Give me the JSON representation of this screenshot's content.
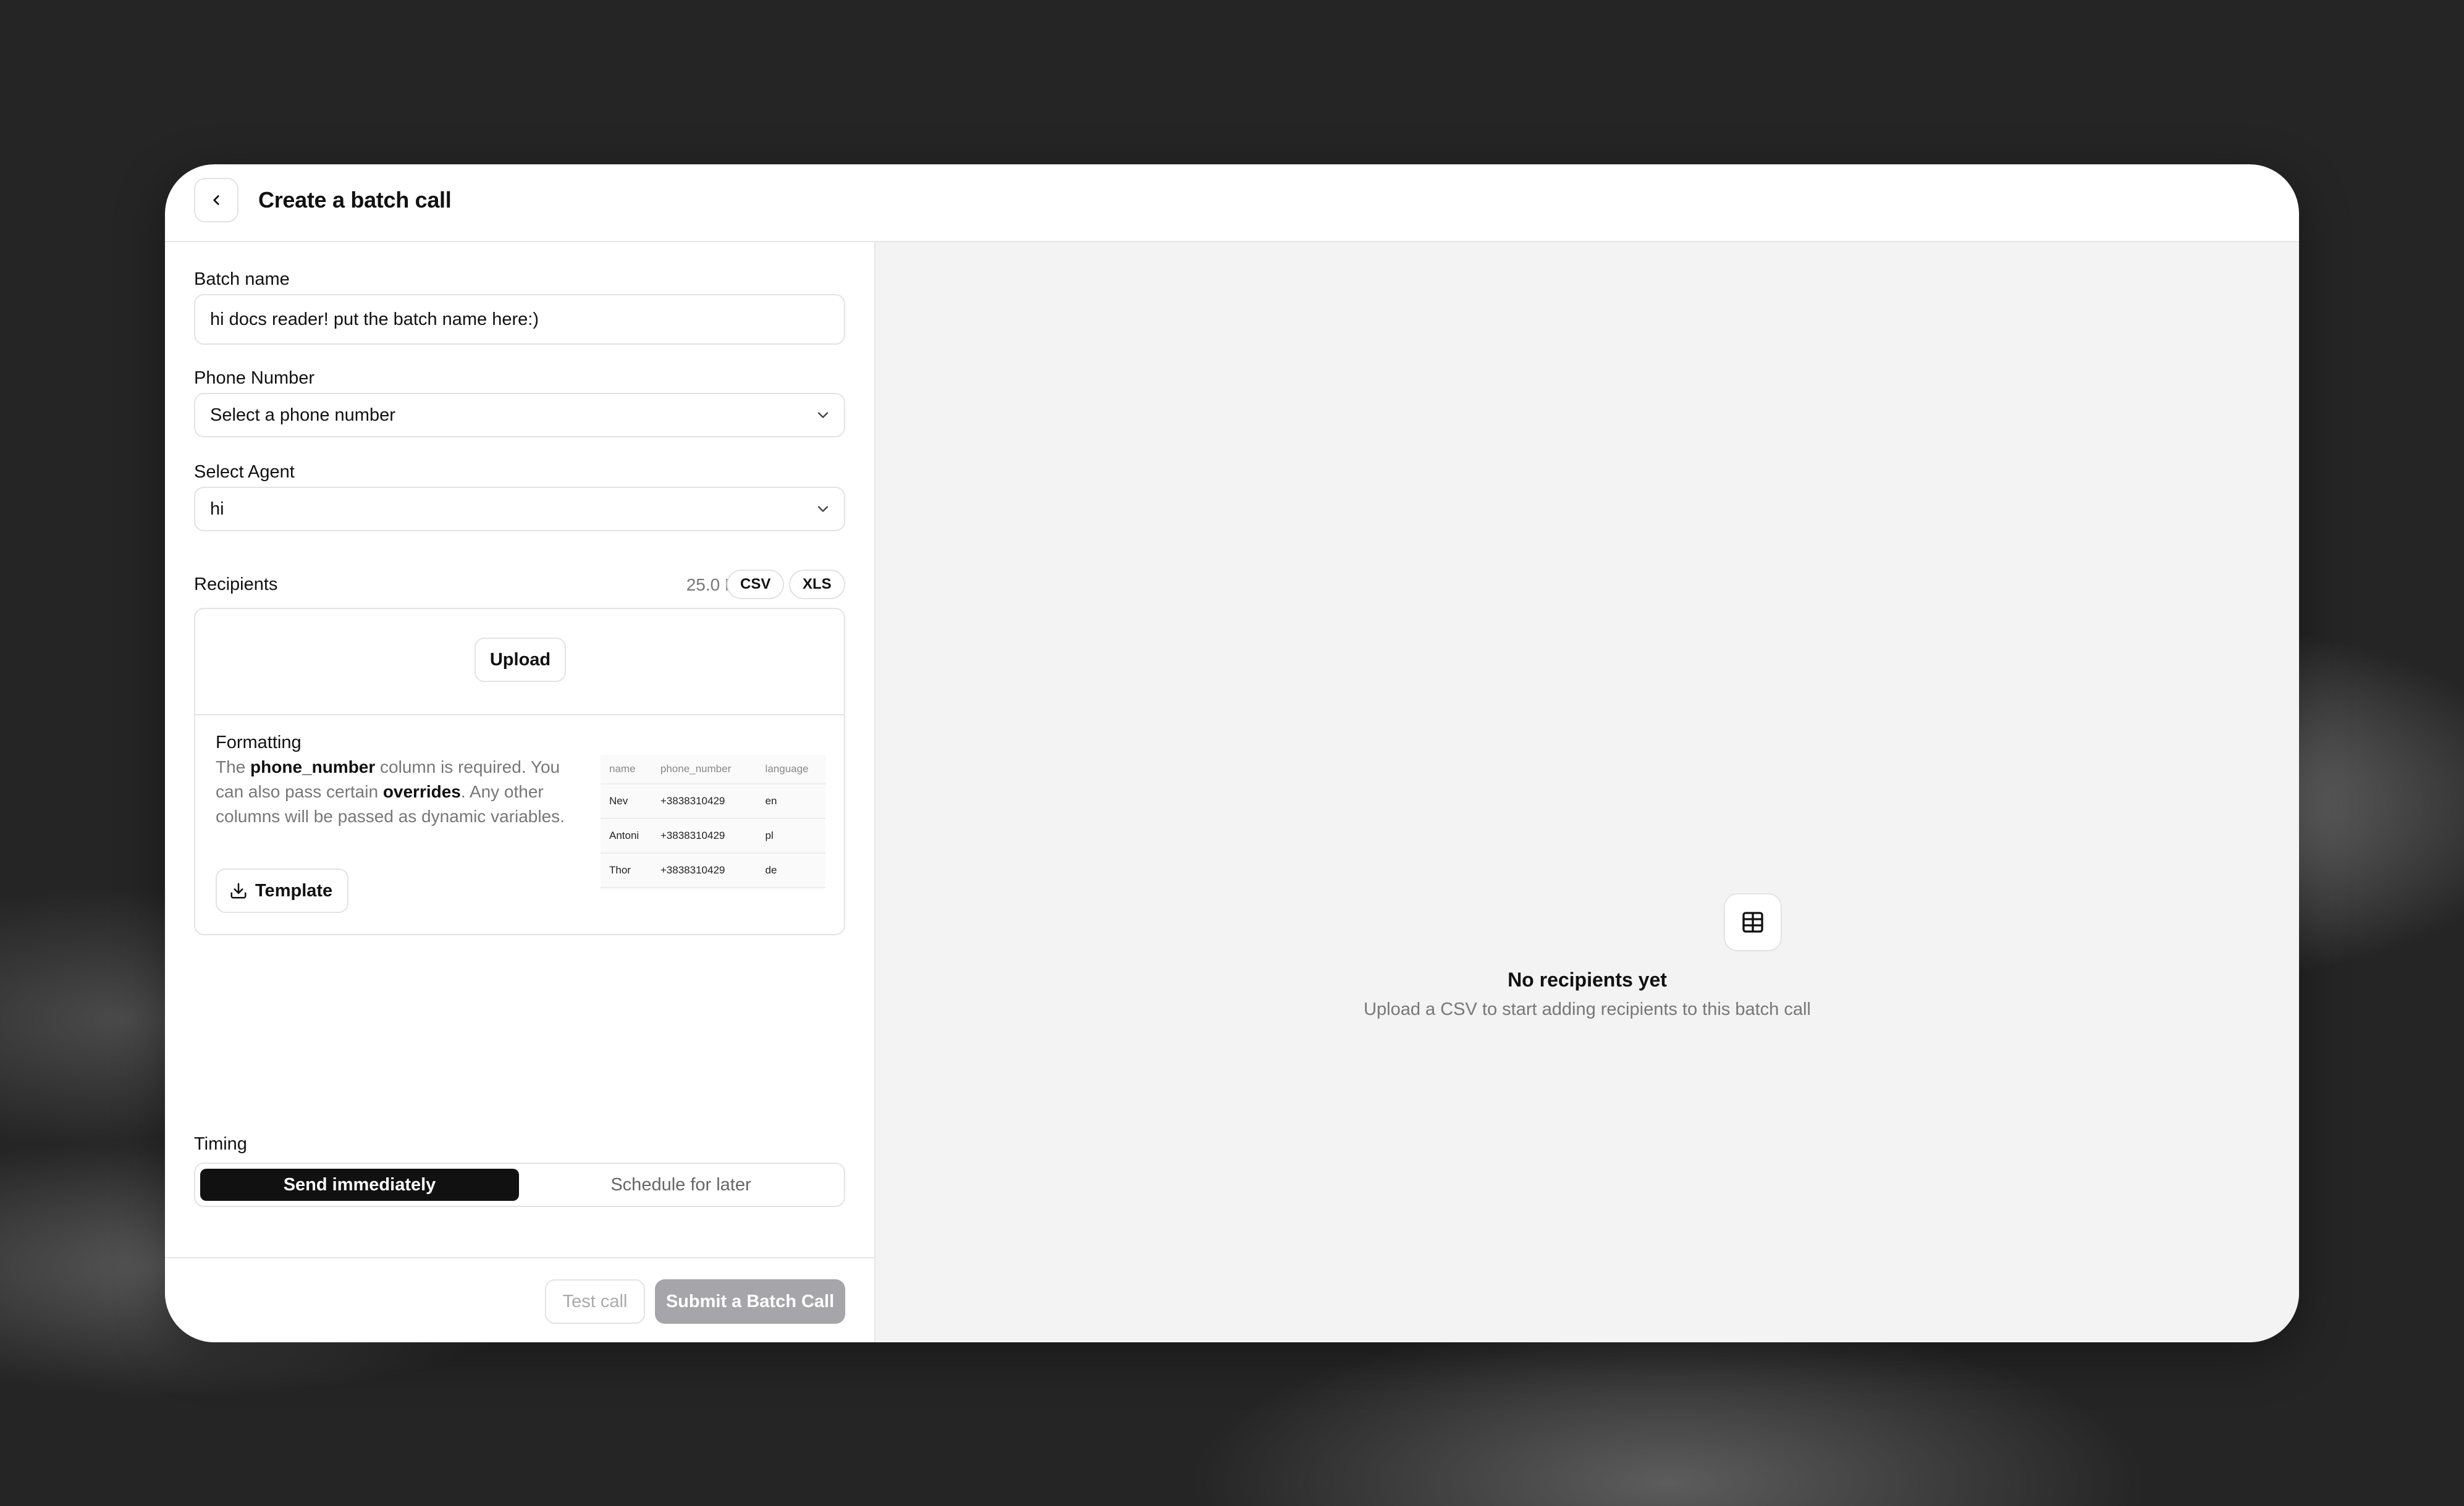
{
  "header": {
    "title": "Create a batch call"
  },
  "form": {
    "batch_name": {
      "label": "Batch name",
      "value": "hi docs reader! put the batch name here:)"
    },
    "phone_number": {
      "label": "Phone Number",
      "value": "Select a phone number"
    },
    "agent": {
      "label": "Select Agent",
      "value": "hi"
    },
    "recipients": {
      "label": "Recipients",
      "max_size": "25.0 MB",
      "formats": [
        "CSV",
        "XLS"
      ],
      "upload_label": "Upload",
      "formatting": {
        "title": "Formatting",
        "text_1": "The ",
        "bold_1": "phone_number",
        "text_2": " column is required. You can also pass certain ",
        "bold_2": "overrides",
        "text_3": ". Any other columns will be passed as dynamic variables.",
        "template_label": "Template"
      },
      "example_table": {
        "columns": [
          "name",
          "phone_number",
          "language"
        ],
        "rows": [
          [
            "Nev",
            "+3838310429",
            "en"
          ],
          [
            "Antoni",
            "+3838310429",
            "pl"
          ],
          [
            "Thor",
            "+3838310429",
            "de"
          ]
        ]
      }
    },
    "timing": {
      "label": "Timing",
      "options": [
        "Send immediately",
        "Schedule for later"
      ],
      "selected": "Send immediately"
    }
  },
  "footer": {
    "test_label": "Test call",
    "submit_label": "Submit a Batch Call"
  },
  "empty_state": {
    "icon": "table-icon",
    "title": "No recipients yet",
    "subtitle": "Upload a CSV to start adding recipients to this batch call"
  },
  "colors": {
    "primary": "#111111",
    "disabled_button": "#a6a6aa",
    "panel_bg": "#f3f3f3"
  }
}
